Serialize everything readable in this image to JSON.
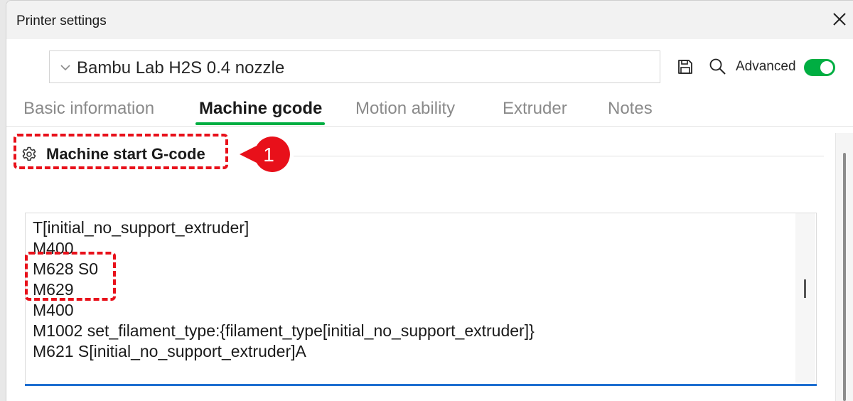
{
  "window": {
    "title": "Printer settings"
  },
  "toolbar": {
    "preset_value": "Bambu Lab H2S 0.4 nozzle",
    "advanced_label": "Advanced",
    "advanced_enabled": true
  },
  "tabs": [
    {
      "label": "Basic information",
      "active": false
    },
    {
      "label": "Machine gcode",
      "active": true
    },
    {
      "label": "Motion ability",
      "active": false
    },
    {
      "label": "Extruder",
      "active": false
    },
    {
      "label": "Notes",
      "active": false
    }
  ],
  "section": {
    "title": "Machine start G-code",
    "icon": "gear-icon"
  },
  "annotation": {
    "callout_number": "1"
  },
  "code_lines": [
    "T[initial_no_support_extruder]",
    "M400",
    "M628 S0",
    "M629",
    "M400",
    "M1002 set_filament_type:{filament_type[initial_no_support_extruder]}",
    "M621 S[initial_no_support_extruder]A"
  ],
  "colors": {
    "accent": "#00ae42",
    "annotation": "#e8101a",
    "focus": "#1e6fd0"
  }
}
